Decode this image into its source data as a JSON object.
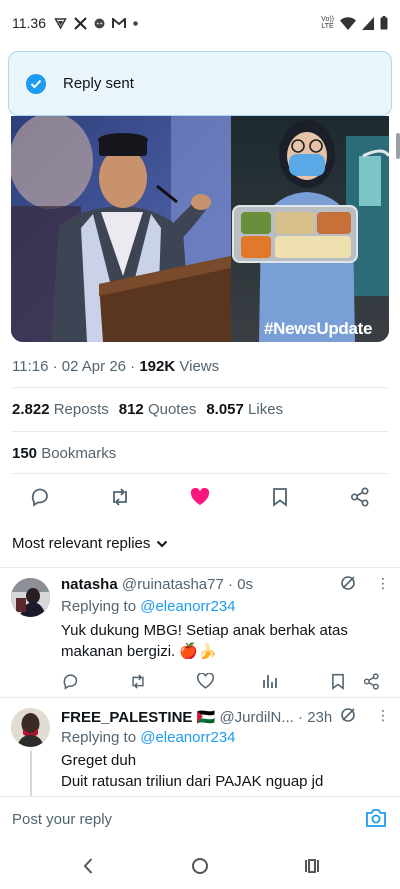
{
  "status_bar": {
    "time": "11.36",
    "volte_line1": "Vo))",
    "volte_line2": "LTE"
  },
  "toast": {
    "text": "Reply sent"
  },
  "media": {
    "watermark": "#NewsUpdate"
  },
  "tweet": {
    "time": "11:16",
    "date": "02 Apr 26",
    "views_count": "192K",
    "views_label": "Views",
    "reposts_count": "2.822",
    "reposts_label": "Reposts",
    "quotes_count": "812",
    "quotes_label": "Quotes",
    "likes_count": "8.057",
    "likes_label": "Likes",
    "bookmarks_count": "150",
    "bookmarks_label": "Bookmarks",
    "liked": true,
    "like_color": "#f91880"
  },
  "replies_header": {
    "label": "Most relevant replies"
  },
  "replies": [
    {
      "name": "natasha",
      "handle": "@ruinatasha77",
      "time": "0s",
      "replying_prefix": "Replying to",
      "replying_to": "@eleanorr234",
      "text": "Yuk dukung MBG! Setiap anak berhak atas makanan bergizi. 🍎🍌"
    },
    {
      "name": "FREE_PALESTINE 🇵🇸",
      "handle": "@JurdilN...",
      "time": "23h",
      "replying_prefix": "Replying to",
      "replying_to": "@eleanorr234",
      "text_line1": "Greget duh",
      "text_line2": "Duit ratusan triliun dari PAJAK nguap jd"
    }
  ],
  "compose": {
    "placeholder": "Post your reply"
  },
  "colors": {
    "accent": "#1d9bf0",
    "text": "#0f1419",
    "muted": "#536471",
    "toast_bg": "#eaf5fb",
    "toast_border": "#a9d8ee"
  }
}
